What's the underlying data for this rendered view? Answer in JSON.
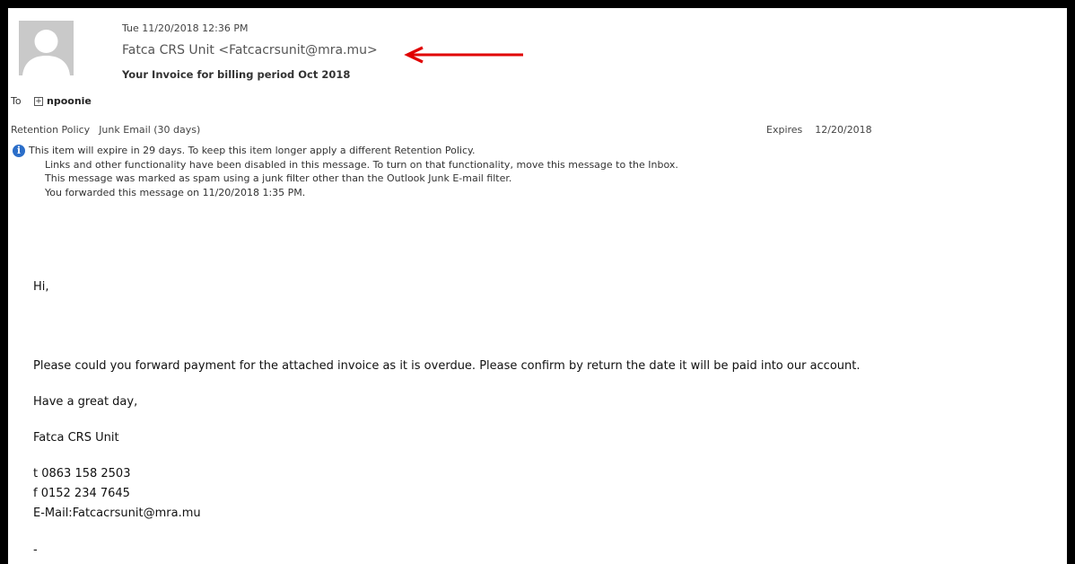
{
  "header": {
    "date": "Tue 11/20/2018 12:36 PM",
    "sender": "Fatca CRS Unit <Fatcacrsunit@mra.mu>",
    "subject": "Your Invoice for billing period Oct 2018"
  },
  "recipients": {
    "to_label": "To",
    "expand_glyph": "+",
    "to_name": "npoonie"
  },
  "retention": {
    "label": "Retention Policy",
    "value": "Junk Email (30 days)",
    "expires_label": "Expires",
    "expires_value": "12/20/2018"
  },
  "infobar": {
    "icon": "info-icon",
    "icon_glyph": "i",
    "lines": [
      "This item will expire in 29 days. To keep this item longer apply a different Retention Policy.",
      "Links and other functionality have been disabled in this message. To turn on that functionality, move this message to the Inbox.",
      "This message was marked as spam using a junk filter other than the Outlook Junk E-mail filter.",
      "You forwarded this message on 11/20/2018 1:35 PM."
    ]
  },
  "body": {
    "greeting": "Hi,",
    "paragraph": "Please could you forward payment for the attached invoice as it  is overdue.  Please confirm by return the date it will be paid into our account.",
    "closing": "Have a great day,",
    "signature_name": "Fatca CRS Unit",
    "phone_t": "t   0863 158 2503",
    "phone_f": "f   0152 234 7645",
    "email": "E-Mail:Fatcacrsunit@mra.mu",
    "trailing": "-"
  },
  "annotation": {
    "arrow_color": "#e00000"
  },
  "colors": {
    "info_icon": "#2b6ec9",
    "frame_border": "#000000"
  }
}
